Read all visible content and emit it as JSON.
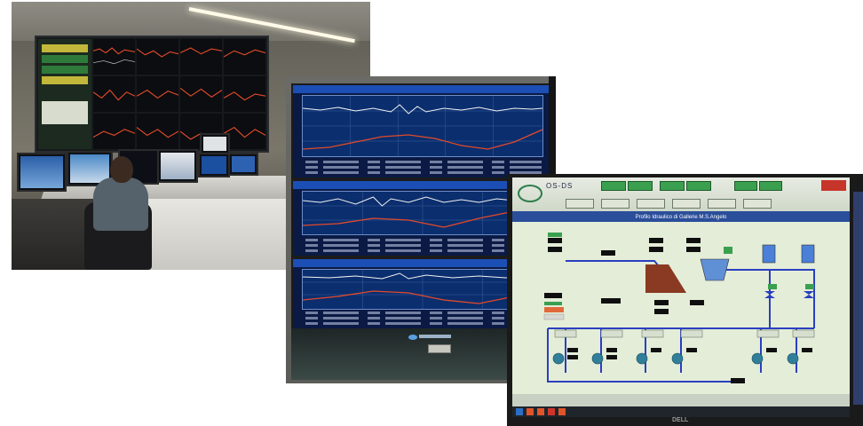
{
  "scene": {
    "photos": [
      {
        "id": "control-room",
        "kind": "photo"
      },
      {
        "id": "trend-screens",
        "kind": "photo"
      },
      {
        "id": "scada-monitor",
        "kind": "photo"
      }
    ]
  },
  "scada": {
    "title": "Profilo Idraulico di Gallerie M.S.Angelo",
    "brand": "OS-DS",
    "monitor_brand": "DELL"
  },
  "colors": {
    "scada_header": "#2a4e9a",
    "scada_bg": "#e4edd8",
    "trend_bg": "#0b2e6e",
    "trend_red": "#e24a2a",
    "trend_white": "#f2f2f2",
    "status_green": "#3aa04f",
    "alarm_red": "#c7342a"
  }
}
